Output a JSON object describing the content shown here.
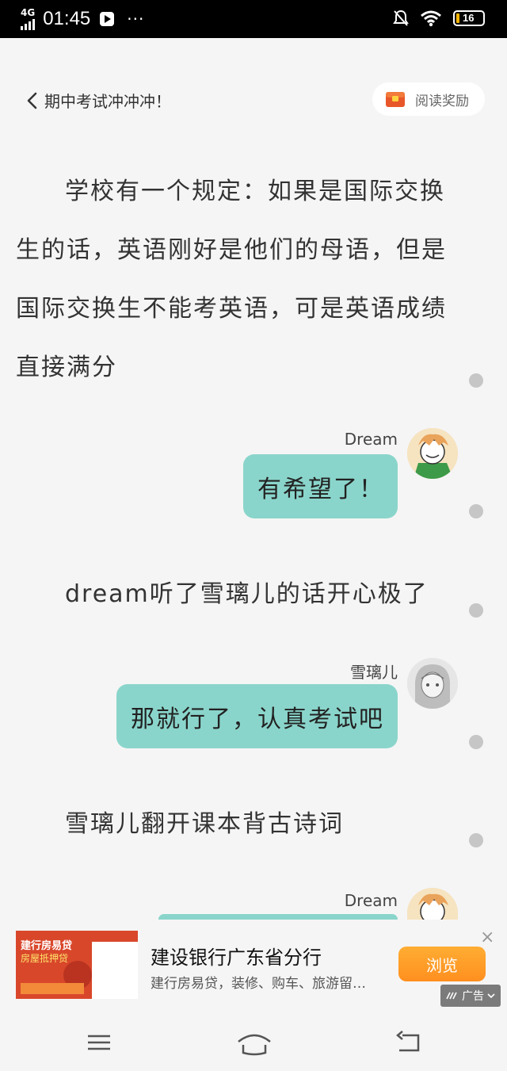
{
  "status_bar": {
    "network": "4G",
    "time": "01:45",
    "more": "···",
    "battery": "16"
  },
  "header": {
    "title": "期中考试冲冲冲！",
    "reward_label": "阅读奖励"
  },
  "story": {
    "paragraph": "学校有一个规定：如果是国际交换生的话，英语刚好是他们的母语，但是国际交换生不能考英语，可是英语成绩直接满分",
    "msg1_name": "Dream",
    "msg1_text": "有希望了！",
    "narration1": "dream听了雪璃儿的话开心极了",
    "msg2_name": "雪璃儿",
    "msg2_text": "那就行了，认真考试吧",
    "narration2": "雪璃儿翻开课本背古诗词",
    "msg3_name": "Dream"
  },
  "ad": {
    "title": "建设银行广东省分行",
    "subtitle": "建行房易贷，装修、购车、旅游留…",
    "button": "浏览",
    "tag": "广告",
    "close": "×",
    "image_text_1": "建行房易贷",
    "image_text_2": "房屋抵押贷"
  },
  "colors": {
    "bubble": "#8ad5cb",
    "button": "#ff9a26",
    "background": "#f5f5f5"
  }
}
